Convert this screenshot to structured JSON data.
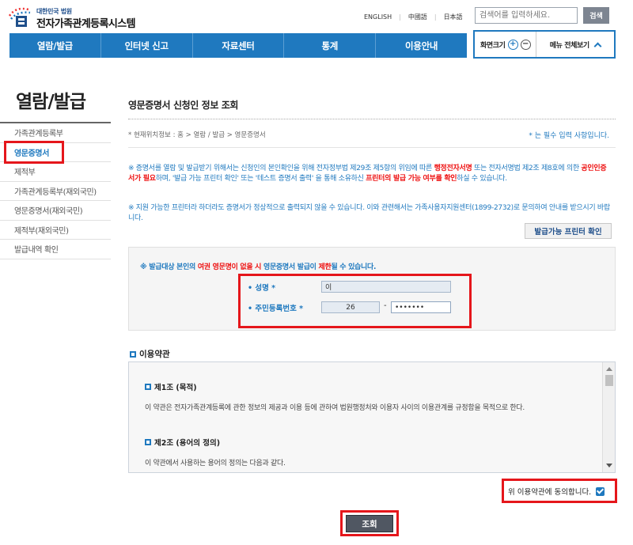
{
  "header": {
    "logo_small": "대한민국 법원",
    "logo_title": "전자가족관계등록시스템",
    "languages": [
      "ENGLISH",
      "中國語",
      "日本語"
    ],
    "search_placeholder": "검색어를 입력하세요.",
    "search_button": "검색"
  },
  "gnb": [
    "열람/발급",
    "인터넷 신고",
    "자료센터",
    "통계",
    "이용안내"
  ],
  "toolbox": {
    "zoom_label": "화면크기",
    "zoom_in": "+",
    "zoom_out": "−",
    "menu_all": "메뉴 전체보기"
  },
  "sidebar": {
    "title": "열람/발급",
    "items": [
      "가족관계등록부",
      "영문증명서",
      "제적부",
      "가족관계등록부(재외국민)",
      "영문증명서(재외국민)",
      "제적부(재외국민)",
      "발급내역 확인"
    ],
    "active_index": 1
  },
  "content": {
    "title": "영문증명서 신청인 정보 조회",
    "breadcrumb": "* 현재위치정보 : 홈 > 열람 / 발급 > 영문증명서",
    "required_note": "* 는 필수 입력 사항입니다.",
    "notice1_a": "※ 증명서를 열람 및 발급받기 위해서는 신청인의 본인확인을 위해 전자정부법 제29조 제5항의 위임에 따른 ",
    "notice1_b": "행정전자서명",
    "notice1_c": " 또는 전자서명법 제2조 제8호에 의한 ",
    "notice1_d": "공인인증서가 필요",
    "notice1_e": "하며, '발급 가능 프린터 확인' 또는 '테스트 증명서 출력' 을 통해 소유하신 ",
    "notice1_f": "프린터의 발급 가능 여부를 확인",
    "notice1_g": "하실 수 있습니다.",
    "notice2": "※ 지원 가능한 프린터라 하더라도 증명서가 정상적으로 출력되지 않을 수 있습니다. 이와 관련해서는 가족사용자지원센터(1899-2732)로 문의하여 안내를 받으시기 바랍니다.",
    "printer_button": "발급가능 프린터 확인"
  },
  "form": {
    "notice_a": "※ 발급대상 본인의 ",
    "notice_b": "여권 영문명이 없을 시",
    "notice_c": " 영문증명서 발급이 ",
    "notice_d": "제한",
    "notice_e": "될 수 있습니다.",
    "name_label": "• 성명 *",
    "name_value": "이",
    "rrn_label": "• 주민등록번호 *",
    "rrn_front": "26",
    "rrn_back": "•••••••"
  },
  "terms": {
    "heading": "이용약관",
    "articles": [
      {
        "title": "제1조 (목적)",
        "body": "이 약관은 전자가족관계등록에 관한 정보의 제공과 이용 등에 관하여 법원행정처와 이용자 사이의 이용관계를 규정함을 목적으로 한다."
      },
      {
        "title": "제2조 (용어의 정의)",
        "body": "이 약관에서 사용하는 용어의 정의는 다음과 같다."
      }
    ],
    "agree_label": "위 이용약관에 동의합니다.",
    "agree_checked": true
  },
  "submit_button": "조회",
  "colors": {
    "primary": "#1f79bf",
    "highlight": "#e5161b",
    "emphasis": "#ee1111"
  }
}
